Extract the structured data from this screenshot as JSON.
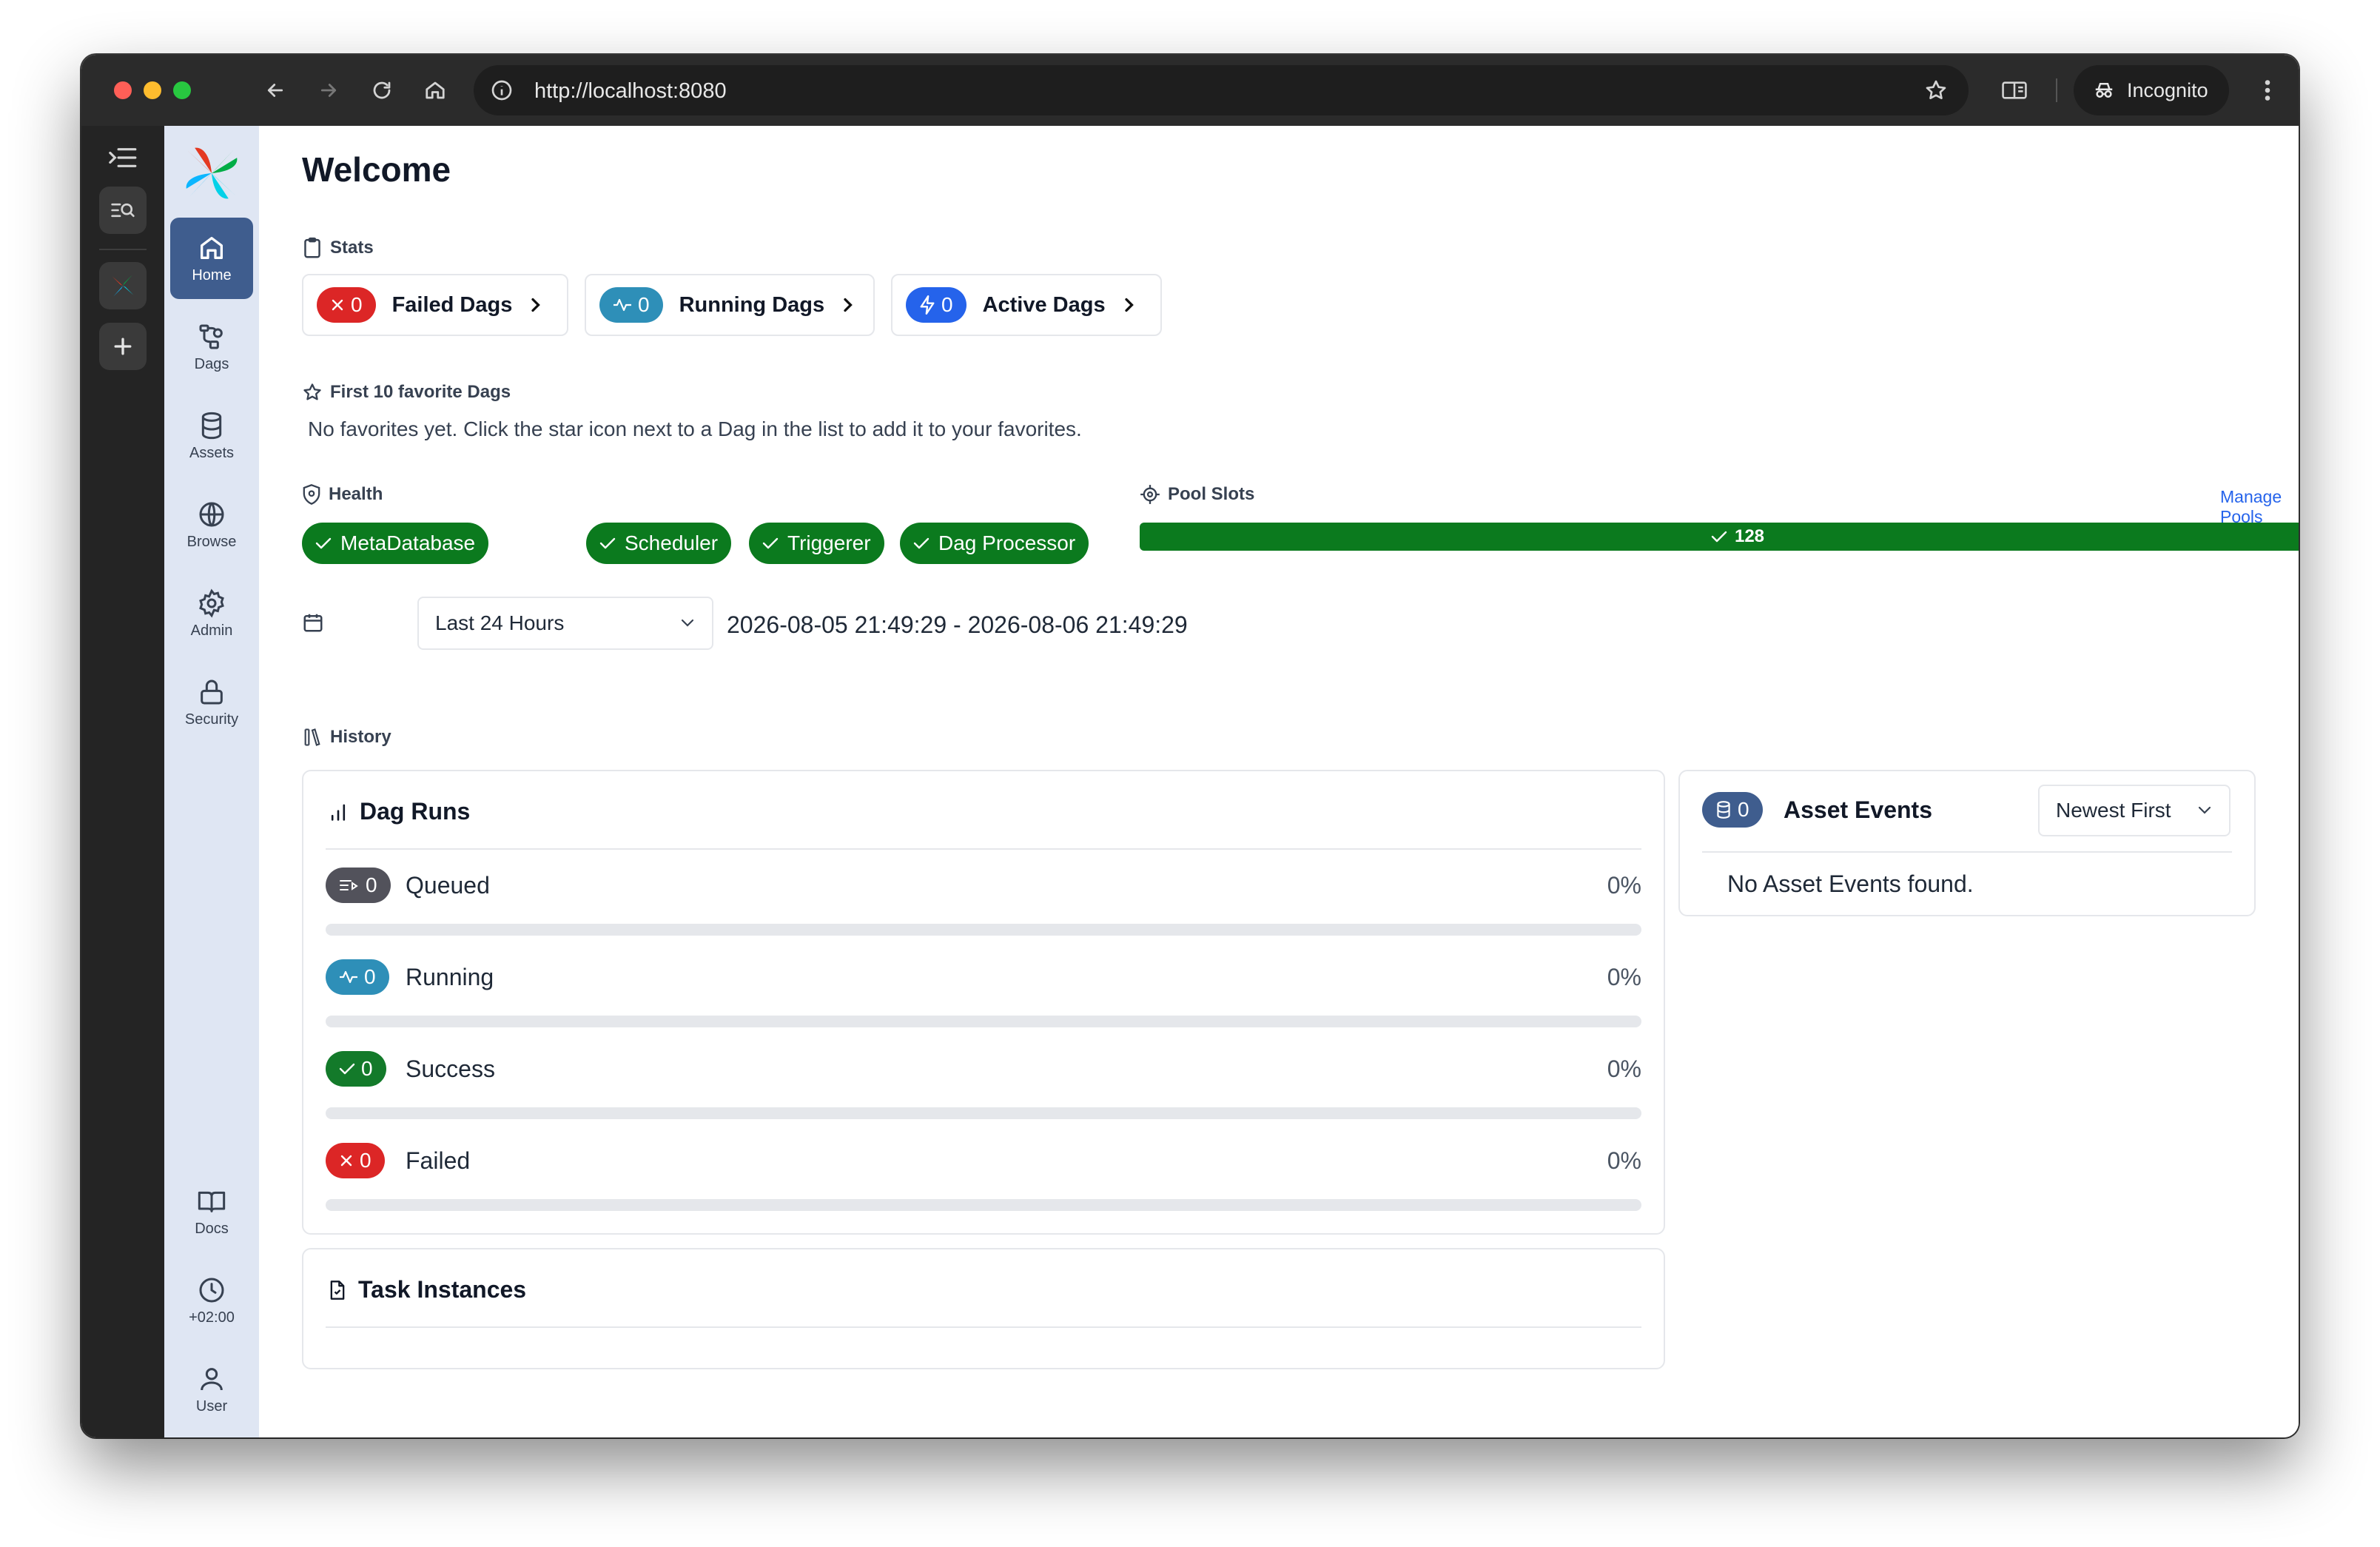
{
  "browser": {
    "url": "http://localhost:8080",
    "mode_label": "Incognito"
  },
  "nav": {
    "items": [
      {
        "label": "Home",
        "icon": "home-icon"
      },
      {
        "label": "Dags",
        "icon": "dags-icon"
      },
      {
        "label": "Assets",
        "icon": "database-icon"
      },
      {
        "label": "Browse",
        "icon": "globe-icon"
      },
      {
        "label": "Admin",
        "icon": "gear-icon"
      },
      {
        "label": "Security",
        "icon": "lock-icon"
      }
    ],
    "bottom": [
      {
        "label": "Docs",
        "icon": "book-icon"
      },
      {
        "label": "+02:00",
        "icon": "clock-icon"
      },
      {
        "label": "User",
        "icon": "user-icon"
      }
    ]
  },
  "page": {
    "title": "Welcome"
  },
  "stats": {
    "label": "Stats",
    "cards": [
      {
        "count": "0",
        "label": "Failed Dags",
        "color": "#dc2626"
      },
      {
        "count": "0",
        "label": "Running Dags",
        "color": "#2e8fb8"
      },
      {
        "count": "0",
        "label": "Active Dags",
        "color": "#2563eb"
      }
    ]
  },
  "favorites": {
    "label": "First 10 favorite Dags",
    "empty_text": "No favorites yet. Click the star icon next to a Dag in the list to add it to your favorites."
  },
  "health": {
    "label": "Health",
    "items": [
      "MetaDatabase",
      "Scheduler",
      "Triggerer",
      "Dag Processor"
    ]
  },
  "pool_slots": {
    "label": "Pool Slots",
    "manage_label": "Manage Pools",
    "value": "128"
  },
  "time_range": {
    "selected": "Last 24 Hours",
    "range_text": "2026-08-05 21:49:29 - 2026-08-06 21:49:29"
  },
  "history": {
    "label": "History",
    "dag_runs": {
      "title": "Dag Runs",
      "rows": [
        {
          "count": "0",
          "label": "Queued",
          "pct": "0%",
          "fraction": 0,
          "color": "#52525b"
        },
        {
          "count": "0",
          "label": "Running",
          "pct": "0%",
          "fraction": 0,
          "color": "#2e8fb8"
        },
        {
          "count": "0",
          "label": "Success",
          "pct": "0%",
          "fraction": 0,
          "color": "#137a2a"
        },
        {
          "count": "0",
          "label": "Failed",
          "pct": "0%",
          "fraction": 0,
          "color": "#dc2626"
        }
      ]
    },
    "task_instances": {
      "title": "Task Instances"
    }
  },
  "asset_events": {
    "count": "0",
    "title": "Asset Events",
    "sort_selected": "Newest First",
    "empty_text": "No Asset Events found."
  }
}
